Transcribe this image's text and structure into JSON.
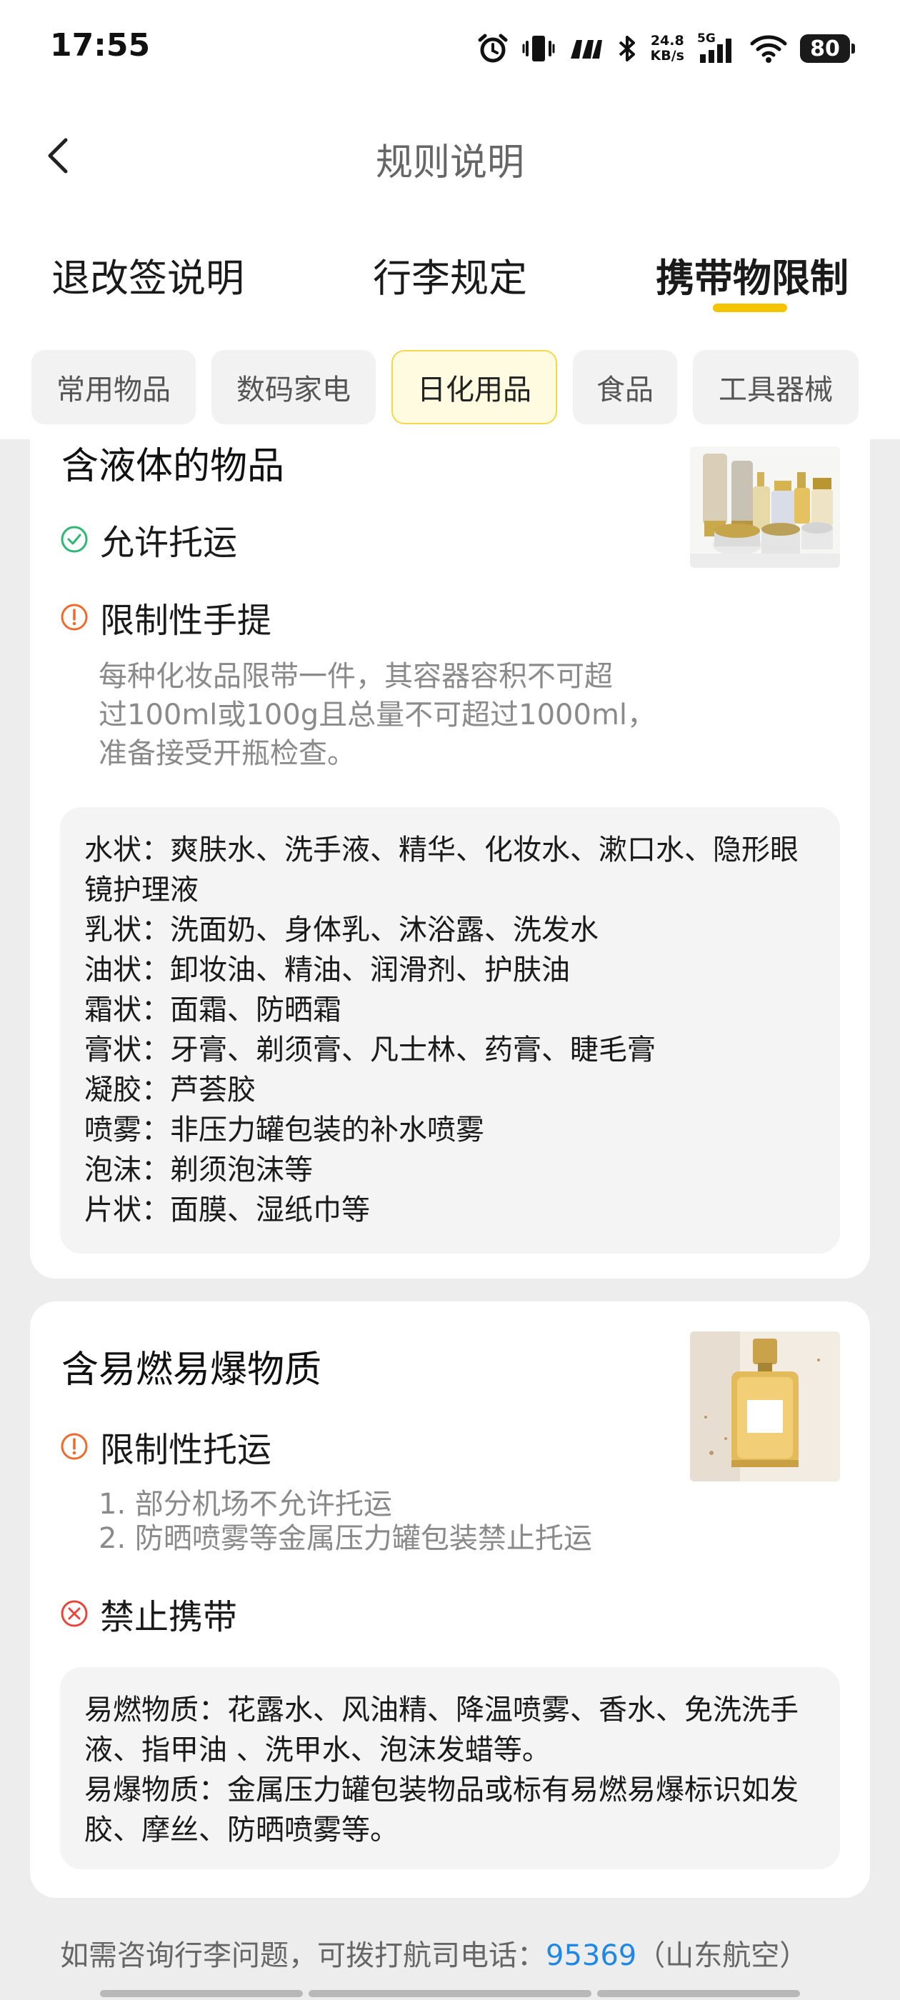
{
  "status_bar": {
    "time": "17:55",
    "net_speed_value": "24.8",
    "net_speed_unit": "KB/s",
    "network_type": "5G",
    "battery": "80",
    "icons": [
      "alarm-icon",
      "vibrate-icon",
      "m-icon",
      "bluetooth-icon",
      "signal-icon",
      "wifi-icon",
      "battery-icon"
    ]
  },
  "header": {
    "title": "规则说明",
    "back_icon": "chevron-left-icon"
  },
  "tabs": [
    {
      "label": "退改签说明",
      "active": false
    },
    {
      "label": "行李规定",
      "active": false
    },
    {
      "label": "携带物限制",
      "active": true
    }
  ],
  "chips": [
    {
      "label": "常用物品",
      "active": false
    },
    {
      "label": "数码家电",
      "active": false
    },
    {
      "label": "日化用品",
      "active": true
    },
    {
      "label": "食品",
      "active": false
    },
    {
      "label": "工具器械",
      "active": false
    }
  ],
  "cards": [
    {
      "title": "含液体的物品",
      "image": "cosmetics-bottles-image",
      "rules": [
        {
          "icon": "check-circle-icon",
          "color": "#2eb872",
          "label": "允许托运"
        },
        {
          "icon": "exclamation-circle-icon",
          "color": "#f06a2a",
          "label": "限制性手提"
        }
      ],
      "note_lines": [
        "每种化妆品限带一件，其容器容积不可超",
        "过100ml或100g且总量不可超过1000ml，",
        "准备接受开瓶检查。"
      ],
      "details": [
        "水状：爽肤水、洗手液、精华、化妆水、漱口水、隐形眼镜护理液",
        "乳状：洗面奶、身体乳、沐浴露、洗发水",
        "油状：卸妆油、精油、润滑剂、护肤油",
        "霜状：面霜、防晒霜",
        "膏状：牙膏、剃须膏、凡士林、药膏、睫毛膏",
        "凝胶：芦荟胶",
        "喷雾：非压力罐包装的补水喷雾",
        "泡沫：剃须泡沫等",
        "片状：面膜、湿纸巾等"
      ]
    },
    {
      "title": "含易燃易爆物质",
      "image": "perfume-bottle-image",
      "rules": [
        {
          "icon": "exclamation-circle-icon",
          "color": "#f06a2a",
          "label": "限制性托运"
        },
        {
          "icon": "x-circle-icon",
          "color": "#e8453c",
          "label": "禁止携带"
        }
      ],
      "note_lines": [
        "1. 部分机场不允许托运",
        "2. 防晒喷雾等金属压力罐包装禁止托运"
      ],
      "details": [
        "易燃物质：花露水、风油精、降温喷雾、香水、免洗洗手液、指甲油 、洗甲水、泡沫发蜡等。",
        "易爆物质：金属压力罐包装物品或标有易燃易爆标识如发胶、摩丝、防晒喷雾等。"
      ]
    }
  ],
  "footer": {
    "text": "如需咨询行李问题，可拨打航司电话：",
    "phone": "95369",
    "airline": "（山东航空）"
  }
}
